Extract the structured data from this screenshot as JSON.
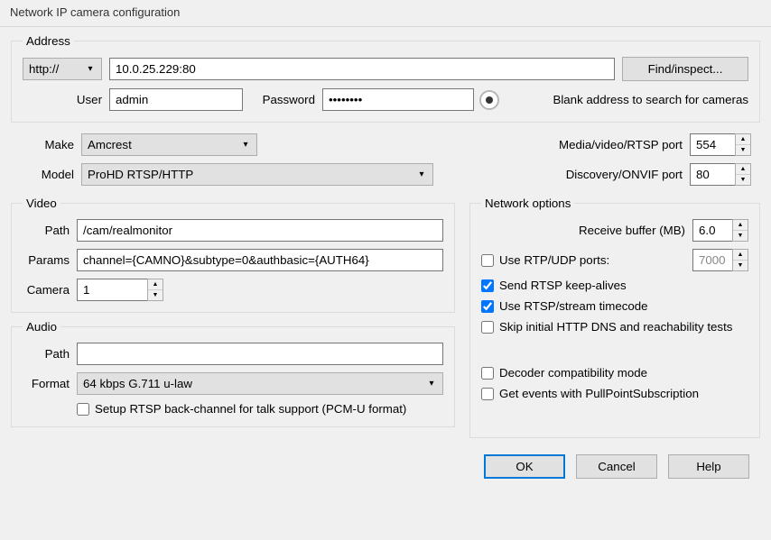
{
  "title": "Network IP camera configuration",
  "address": {
    "legend": "Address",
    "scheme": "http://",
    "url": "10.0.25.229:80",
    "find_btn": "Find/inspect...",
    "user_label": "User",
    "user": "admin",
    "password_label": "Password",
    "password": "••••••••",
    "blank_hint": "Blank address to search for cameras"
  },
  "makemodel": {
    "make_label": "Make",
    "make": "Amcrest",
    "model_label": "Model",
    "model": "ProHD RTSP/HTTP",
    "rtsp_port_label": "Media/video/RTSP port",
    "rtsp_port": "554",
    "onvif_port_label": "Discovery/ONVIF port",
    "onvif_port": "80"
  },
  "video": {
    "legend": "Video",
    "path_label": "Path",
    "path": "/cam/realmonitor",
    "params_label": "Params",
    "params": "channel={CAMNO}&subtype=0&authbasic={AUTH64}",
    "camera_label": "Camera",
    "camera": "1"
  },
  "audio": {
    "legend": "Audio",
    "path_label": "Path",
    "path": "",
    "format_label": "Format",
    "format": "64 kbps G.711 u-law",
    "backchannel": "Setup RTSP back-channel for talk support (PCM-U format)"
  },
  "netopts": {
    "legend": "Network options",
    "recv_buf_label": "Receive buffer (MB)",
    "recv_buf": "6.0",
    "use_rtp": "Use RTP/UDP ports:",
    "rtp_port": "7000",
    "keepalive": "Send RTSP keep-alives",
    "timecode": "Use RTSP/stream timecode",
    "skipdns": "Skip initial HTTP DNS and reachability tests",
    "compat": "Decoder compatibility mode",
    "pullpoint": "Get events with PullPointSubscription"
  },
  "buttons": {
    "ok": "OK",
    "cancel": "Cancel",
    "help": "Help"
  }
}
